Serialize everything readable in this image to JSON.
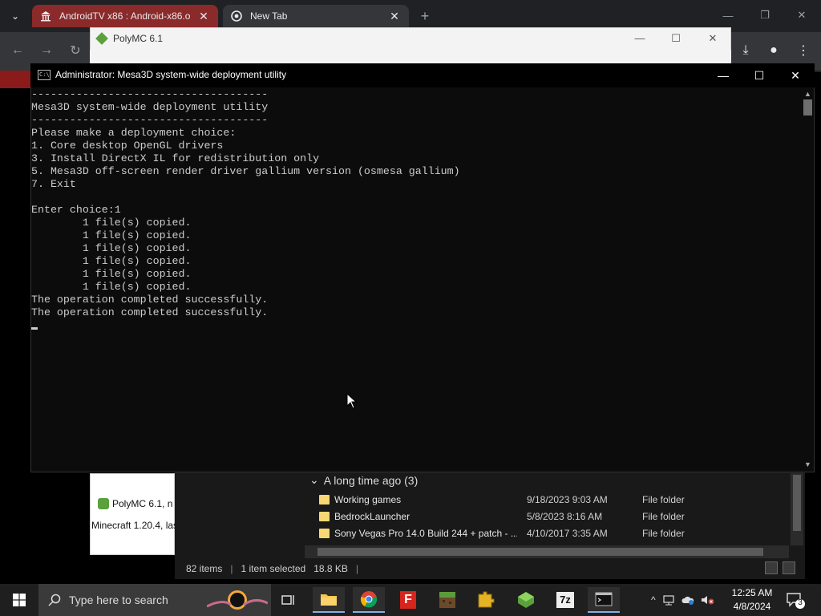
{
  "chrome": {
    "tabs": [
      {
        "title": "AndroidTV x86 : Android-x86.o"
      },
      {
        "title": "New Tab"
      }
    ],
    "new_tab": "+",
    "tab_close": "✕",
    "win_min": "—",
    "win_max": "❐",
    "win_close": "✕",
    "nav": {
      "back": "←",
      "forward": "→",
      "reload": "↻",
      "download": "⤓",
      "profile": "●",
      "menu": "⋮"
    },
    "tab_dropdown": "⌄"
  },
  "polymc": {
    "title": "PolyMC 6.1",
    "min": "—",
    "max": "☐",
    "close": "✕"
  },
  "explorer": {
    "left_item": "PolyMC 6.1, n",
    "left_version": "Minecraft 1.20.4, las",
    "group_header": "A long time ago (3)",
    "group_chevron": "⌄",
    "rows": [
      {
        "name": "Working games",
        "date": "9/18/2023 9:03 AM",
        "type": "File folder"
      },
      {
        "name": "BedrockLauncher",
        "date": "5/8/2023 8:16 AM",
        "type": "File folder"
      },
      {
        "name": "Sony Vegas Pro 14.0 Build 244 + patch - ...",
        "date": "4/10/2017 3:35 AM",
        "type": "File folder"
      }
    ],
    "status": {
      "items": "82 items",
      "selected": "1 item selected",
      "size": "18.8 KB",
      "sep": "|"
    }
  },
  "cmd": {
    "title": "Administrator:  Mesa3D system-wide deployment utility",
    "icon_text": "C:\\",
    "min": "—",
    "max": "☐",
    "close": "✕",
    "console": "-------------------------------------\nMesa3D system-wide deployment utility\n-------------------------------------\nPlease make a deployment choice:\n1. Core desktop OpenGL drivers\n3. Install DirectX IL for redistribution only\n5. Mesa3D off-screen render driver gallium version (osmesa gallium)\n7. Exit\n\nEnter choice:1\n        1 file(s) copied.\n        1 file(s) copied.\n        1 file(s) copied.\n        1 file(s) copied.\n        1 file(s) copied.\n        1 file(s) copied.\nThe operation completed successfully.\nThe operation completed successfully.",
    "scroll_up": "▲",
    "scroll_down": "▼"
  },
  "taskbar": {
    "search_placeholder": "Type here to search",
    "time": "12:25 AM",
    "date": "4/8/2024",
    "notification_count": "3",
    "icons": [
      "file-explorer-icon",
      "chrome-icon",
      "foxit-reader-icon",
      "minecraft-icon",
      "puzzle-app-icon",
      "polymc-icon",
      "7zip-icon",
      "cmd-icon"
    ],
    "seven_zip_label": "7z",
    "f_label": "F",
    "tray_chevron": "^"
  }
}
